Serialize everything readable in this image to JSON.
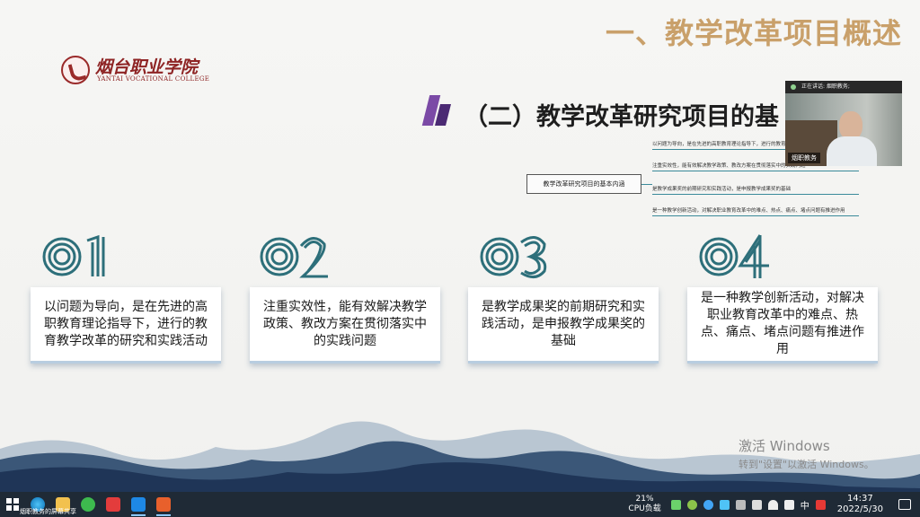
{
  "slide": {
    "main_title": "一、教学改革项目概述",
    "logo_cn": "烟台职业学院",
    "logo_en": "YANTAI VOCATIONAL COLLEGE",
    "sub_title": "（二）教学改革研究项目的基"
  },
  "mindmap": {
    "root": "教学改革研究项目的基本内涵",
    "branches": [
      "以问题为导向，是在先进的高职教育理论指导下，进行的教育教学",
      "注重实效性，能有效解决教学政策、教改方案在贯彻落实中的实践问题",
      "是教学成果奖的前期研究和实践活动，是申报教学成果奖的基础",
      "是一种教学创新活动，对解决职业教育改革中的难点、热点、痛点、堵点问题有推进作用"
    ]
  },
  "cards": [
    {
      "num": "01",
      "text": "以问题为导向，是在先进的高职教育理论指导下，进行的教育教学改革的研究和实践活动"
    },
    {
      "num": "02",
      "text": "注重实效性，能有效解决教学政策、教改方案在贯彻落实中的实践问题"
    },
    {
      "num": "03",
      "text": "是教学成果奖的前期研究和实践活动，是申报教学成果奖的基础"
    },
    {
      "num": "04",
      "text": "是一种教学创新活动，对解决职业教育改革中的难点、热点、痛点、堵点问题有推进作用"
    }
  ],
  "video": {
    "speaking": "正在讲话: 烟职教务;",
    "name": "烟职教务"
  },
  "watermark": {
    "line1": "激活 Windows",
    "line2": "转到\"设置\"以激活 Windows。"
  },
  "taskbar": {
    "share_label": "烟职教务的屏幕共享",
    "cpu_percent": "21%",
    "cpu_label": "CPU负载",
    "lang": "中",
    "time": "14:37",
    "date": "2022/5/30",
    "colors": {
      "bar": "#1f2a36",
      "accent": "#8cc8ff"
    }
  }
}
